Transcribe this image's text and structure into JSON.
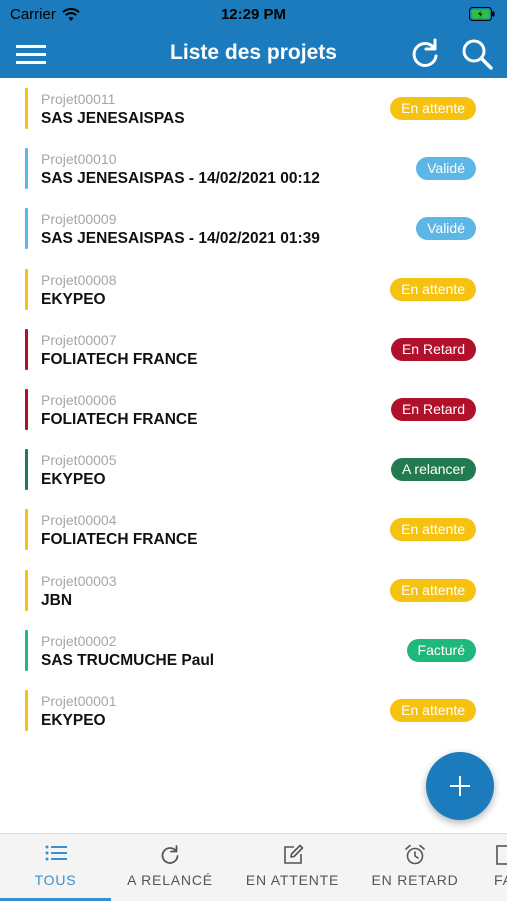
{
  "status_bar": {
    "carrier": "Carrier",
    "time": "12:29 PM"
  },
  "header": {
    "title": "Liste des projets"
  },
  "colors": {
    "primary": "#1b7bbd",
    "en_attente": "#f6c210",
    "valide": "#5cb6e6",
    "en_retard": "#b0102a",
    "a_relancer": "#237a4f",
    "facture": "#1fb87c"
  },
  "projects": [
    {
      "code": "Projet00011",
      "name": "SAS JENESAISPAS",
      "status": "En attente",
      "color": "#f6c210"
    },
    {
      "code": "Projet00010",
      "name": "SAS JENESAISPAS - 14/02/2021 00:12",
      "status": "Validé",
      "color": "#5cb6e6"
    },
    {
      "code": "Projet00009",
      "name": "SAS JENESAISPAS - 14/02/2021 01:39",
      "status": "Validé",
      "color": "#5cb6e6"
    },
    {
      "code": "Projet00008",
      "name": "EKYPEO",
      "status": "En attente",
      "color": "#f6c210"
    },
    {
      "code": "Projet00007",
      "name": "FOLIATECH FRANCE",
      "status": "En Retard",
      "color": "#b0102a"
    },
    {
      "code": "Projet00006",
      "name": "FOLIATECH FRANCE",
      "status": "En Retard",
      "color": "#b0102a"
    },
    {
      "code": "Projet00005",
      "name": "EKYPEO",
      "status": "A relancer",
      "color": "#237a4f"
    },
    {
      "code": "Projet00004",
      "name": "FOLIATECH FRANCE",
      "status": "En attente",
      "color": "#f6c210"
    },
    {
      "code": "Projet00003",
      "name": "JBN",
      "status": "En attente",
      "color": "#f6c210"
    },
    {
      "code": "Projet00002",
      "name": "SAS TRUCMUCHE Paul",
      "status": "Facturé",
      "color": "#1fb87c"
    },
    {
      "code": "Projet00001",
      "name": "EKYPEO",
      "status": "En attente",
      "color": "#f6c210"
    }
  ],
  "tabs": [
    {
      "label": "TOUS",
      "icon": "list-icon",
      "active": true
    },
    {
      "label": "A RELANCÉ",
      "icon": "refresh-icon",
      "active": false
    },
    {
      "label": "EN ATTENTE",
      "icon": "edit-icon",
      "active": false
    },
    {
      "label": "EN RETARD",
      "icon": "alarm-clock-icon",
      "active": false
    },
    {
      "label": "FA",
      "icon": "invoice-icon",
      "active": false
    }
  ]
}
